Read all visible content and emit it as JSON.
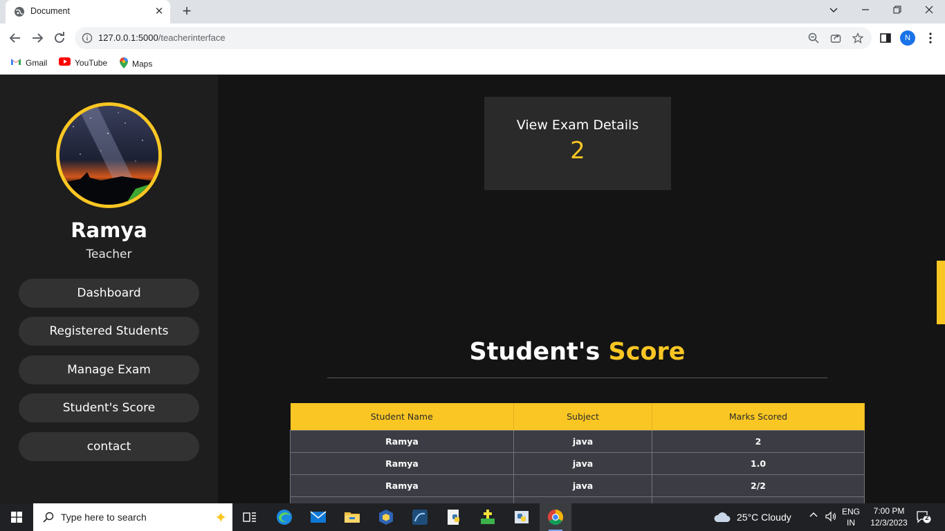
{
  "browser": {
    "tab_title": "Document",
    "url_host": "127.0.0.1:5000",
    "url_path": "/teacherinterface",
    "profile_initial": "N",
    "bookmarks": [
      {
        "label": "Gmail",
        "icon": "gmail-icon"
      },
      {
        "label": "YouTube",
        "icon": "youtube-icon"
      },
      {
        "label": "Maps",
        "icon": "maps-icon"
      }
    ]
  },
  "sidebar": {
    "name": "Ramya",
    "role": "Teacher",
    "nav": [
      {
        "label": "Dashboard"
      },
      {
        "label": "Registered Students"
      },
      {
        "label": "Manage Exam"
      },
      {
        "label": "Student's Score"
      },
      {
        "label": "contact"
      }
    ]
  },
  "card": {
    "title": "View Exam Details",
    "value": "2"
  },
  "score_section": {
    "title_main": "Student's",
    "title_accent": "Score",
    "columns": [
      "Student Name",
      "Subject",
      "Marks Scored"
    ],
    "rows": [
      [
        "Ramya",
        "java",
        "2"
      ],
      [
        "Ramya",
        "java",
        "1.0"
      ],
      [
        "Ramya",
        "java",
        "2/2"
      ],
      [
        "",
        "",
        ""
      ]
    ]
  },
  "colors": {
    "accent": "#f9c623",
    "sidebar_bg": "#1e1e1e",
    "page_bg": "#141414",
    "card_bg": "#2a2a2a",
    "table_row_bg": "#3c3d44"
  },
  "taskbar": {
    "search_placeholder": "Type here to search",
    "weather": "25°C  Cloudy",
    "lang_top": "ENG",
    "lang_bottom": "IN",
    "time": "7:00 PM",
    "date": "12/3/2023",
    "notification_count": "2"
  }
}
